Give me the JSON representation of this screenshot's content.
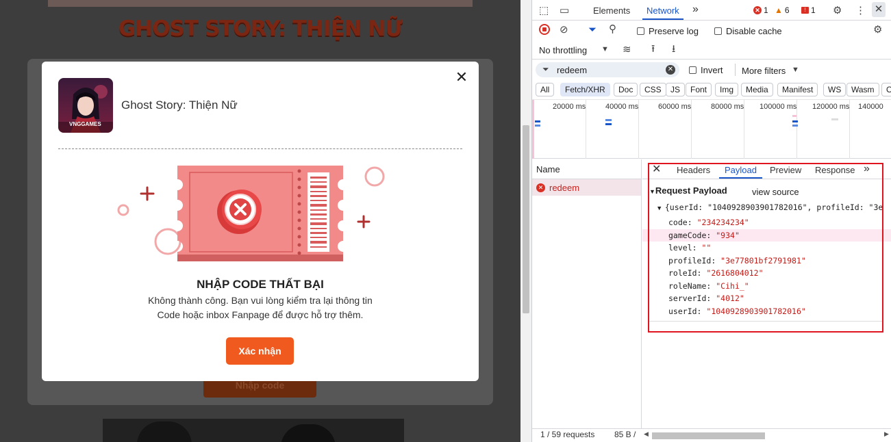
{
  "page": {
    "bg_title": "GHOST STORY: THIỆN NỮ",
    "bg_button": "Nhập code"
  },
  "modal": {
    "game_name": "Ghost Story: Thiện Nữ",
    "icon_brand": "VNGGAMES",
    "title": "NHẬP CODE THẤT BẠI",
    "message_line1": "Không thành công. Bạn vui lòng kiểm tra lại thông tin",
    "message_line2": "Code hoặc inbox Fanpage để được hỗ trợ thêm.",
    "confirm_label": "Xác nhận",
    "close_label": "✕"
  },
  "devtools": {
    "tabs": [
      "Elements",
      "Network"
    ],
    "active_tab": "Network",
    "more_tabs": "»",
    "errors": "1",
    "warnings": "6",
    "issues": "1",
    "preserve_log": "Preserve log",
    "disable_cache": "Disable cache",
    "throttling": "No throttling",
    "filter_value": "redeem",
    "invert": "Invert",
    "more_filters": "More filters",
    "type_filters": [
      "All",
      "Fetch/XHR",
      "Doc",
      "CSS",
      "JS",
      "Font",
      "Img",
      "Media",
      "Manifest",
      "WS",
      "Wasm",
      "O"
    ],
    "active_filter": "Fetch/XHR",
    "timeline_labels": [
      "20000 ms",
      "40000 ms",
      "60000 ms",
      "80000 ms",
      "100000 ms",
      "120000 ms",
      "140000"
    ],
    "name_header": "Name",
    "request_name": "redeem",
    "detail_tabs": [
      "Headers",
      "Payload",
      "Preview",
      "Response"
    ],
    "active_detail_tab": "Payload",
    "payload_title": "Request Payload",
    "view_source": "view source",
    "json_summary": "{userId: \"1040928903901782016\", profileId: \"3e",
    "payload": [
      {
        "key": "code",
        "value": "\"234234234\""
      },
      {
        "key": "gameCode",
        "value": "\"934\""
      },
      {
        "key": "level",
        "value": "\"\""
      },
      {
        "key": "profileId",
        "value": "\"3e77801bf2791981\""
      },
      {
        "key": "roleId",
        "value": "\"2616804012\""
      },
      {
        "key": "roleName",
        "value": "\"Cihi_\""
      },
      {
        "key": "serverId",
        "value": "\"4012\""
      },
      {
        "key": "userId",
        "value": "\"1040928903901782016\""
      }
    ],
    "status_requests": "1 / 59 requests",
    "status_size": "85 B /"
  },
  "colors": {
    "accent_orange": "#f05a1e",
    "ticket_pink": "#f08080",
    "devtools_blue": "#1a55c8",
    "highlight_red": "#e0141e"
  }
}
